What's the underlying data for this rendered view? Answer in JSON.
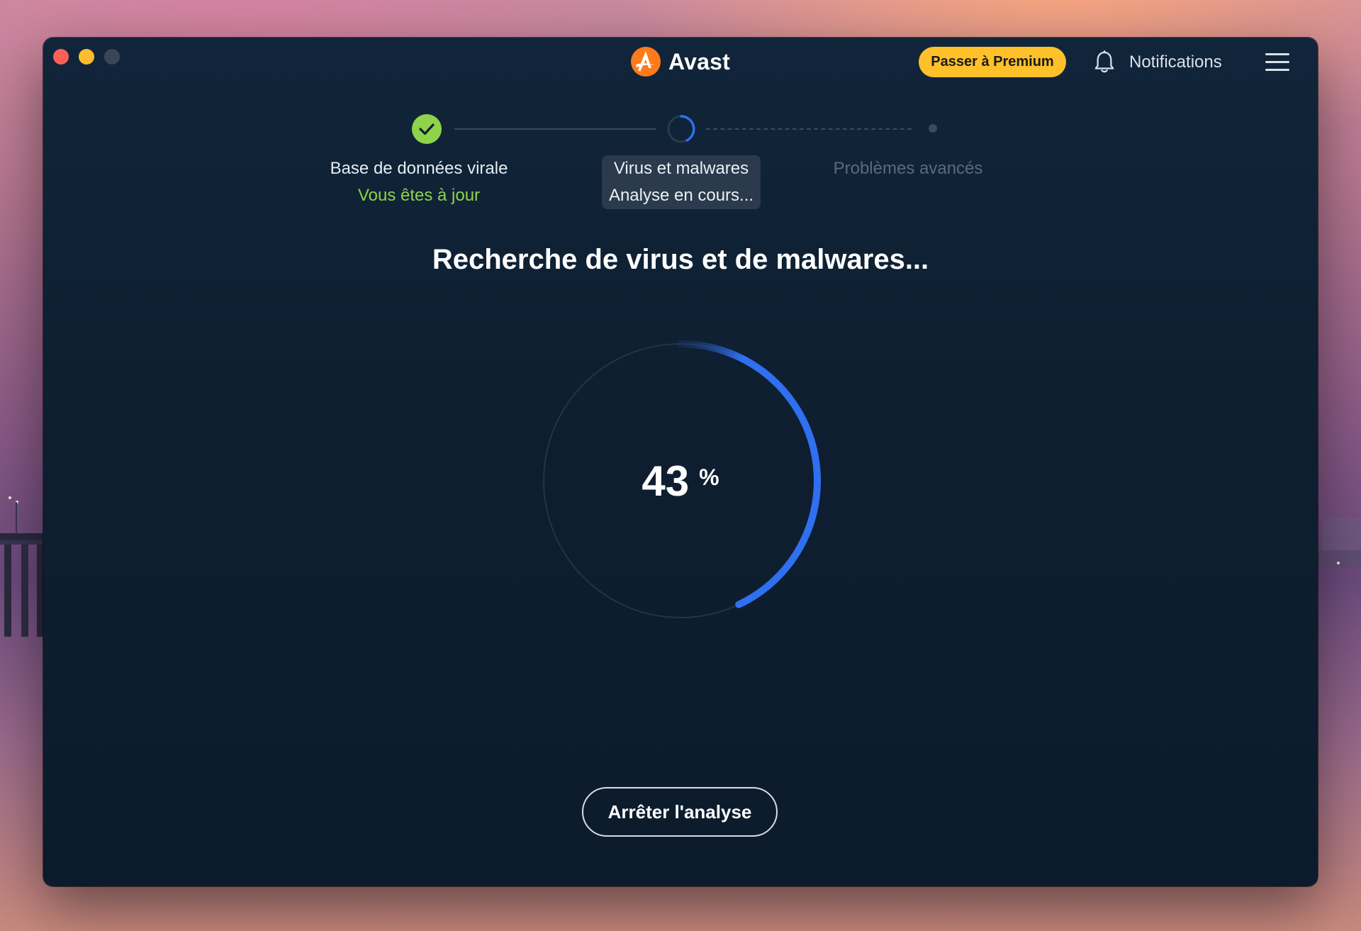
{
  "app": {
    "name": "Avast",
    "logo_icon": "avast-logo-icon",
    "accent_color": "#ff7a1a"
  },
  "header": {
    "premium_label": "Passer à Premium",
    "notifications_label": "Notifications",
    "notifications_icon": "bell-icon",
    "menu_icon": "hamburger-menu-icon"
  },
  "steps": [
    {
      "title": "Base de données virale",
      "status": "Vous êtes à jour",
      "state": "done",
      "color": "#8ed34a"
    },
    {
      "title": "Virus et malwares",
      "status": "Analyse en cours...",
      "state": "active",
      "color": "#2f6ff0"
    },
    {
      "title": "Problèmes avancés",
      "status": "",
      "state": "pending",
      "color": "#3b4a5c"
    }
  ],
  "scan": {
    "heading": "Recherche de virus et de malwares...",
    "progress_value": "43",
    "progress_fraction": 0.43,
    "progress_unit": "%",
    "progress_color": "#2f6ff0"
  },
  "actions": {
    "stop_label": "Arrêter l'analyse"
  }
}
